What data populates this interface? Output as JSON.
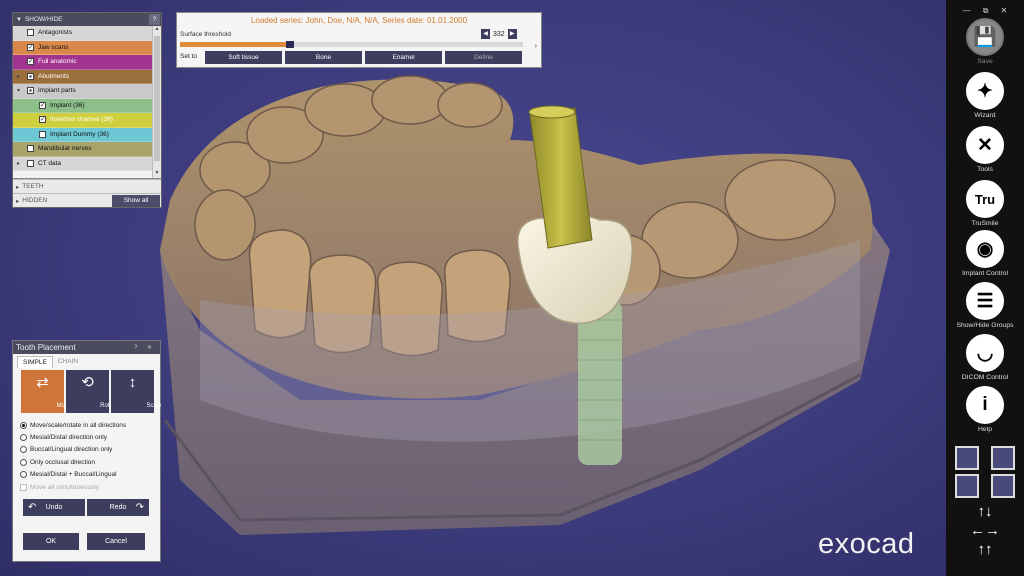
{
  "showhide": {
    "header": "SHOW/HIDE",
    "help": "?",
    "rows": [
      {
        "label": "Antagonists",
        "bg": "#d6d6d6",
        "checked": false,
        "exp": ""
      },
      {
        "label": "Jaw scans",
        "bg": "#d9884b",
        "checked": true,
        "exp": ""
      },
      {
        "label": "Full anatomic",
        "bg": "#a2338e",
        "checked": true,
        "exp": ""
      },
      {
        "label": "Abutments",
        "bg": "#9b6f3b",
        "checked": false,
        "exp": "▸",
        "filled": true
      },
      {
        "label": "Implant parts",
        "bg": "#c9c9c9",
        "checked": false,
        "exp": "▾",
        "filled": true
      },
      {
        "label": "Implant (36)",
        "bg": "#8dbf8a",
        "checked": true,
        "exp": "",
        "indent": true
      },
      {
        "label": "Insertion channel (36)",
        "bg": "#cfcf3e",
        "checked": true,
        "exp": "",
        "indent": true
      },
      {
        "label": "Implant Dummy (36)",
        "bg": "#6ec7d4",
        "checked": false,
        "exp": "",
        "indent": true
      },
      {
        "label": "Mandibular nerves",
        "bg": "#a8a36a",
        "checked": false,
        "exp": ""
      },
      {
        "label": "CT data",
        "bg": "#d6d6d6",
        "checked": false,
        "exp": "▸"
      }
    ],
    "teeth": "TEETH",
    "hidden": "HIDDEN",
    "show_all": "Show all"
  },
  "series": {
    "title": "Loaded series: John, Doe, N/A, N/A, Series date: 01.01.2000",
    "threshold_label": "Surface threshold",
    "threshold_value": "332",
    "threshold_fraction": 0.32,
    "set_to": "Set to",
    "buttons": [
      "Soft tissue",
      "Bone",
      "Enamel",
      "Define"
    ]
  },
  "tooth": {
    "title": "Tooth Placement",
    "header_icons": "? ✕",
    "tabs": [
      "SIMPLE",
      "CHAIN"
    ],
    "modes": [
      {
        "label": "Move",
        "icon": "⇄"
      },
      {
        "label": "Rotate",
        "icon": "⟲"
      },
      {
        "label": "Scale",
        "icon": "↕"
      }
    ],
    "options": [
      "Move/scale/rotate in all directions",
      "Mesial/Distal direction only",
      "Buccal/Lingual direction only",
      "Only occlusal direction",
      "Mesial/Distal + Buccal/Lingual"
    ],
    "move_all": "Move all simultaneously",
    "undo": "Undo",
    "redo": "Redo",
    "ok": "OK",
    "cancel": "Cancel"
  },
  "toolbar": {
    "win": [
      "—",
      "⧉",
      "✕"
    ],
    "tools": [
      {
        "label": "Save",
        "icon": "floppy-icon",
        "glyph": "💾"
      },
      {
        "label": "Wizard",
        "icon": "wand-icon",
        "glyph": "✦"
      },
      {
        "label": "Tools",
        "icon": "wrench-icon",
        "glyph": "✕"
      },
      {
        "label": "TruSmile",
        "icon": "trusmile-icon",
        "glyph": "Tru"
      },
      {
        "label": "Implant Control",
        "icon": "implant-icon",
        "glyph": "◉"
      },
      {
        "label": "Show/Hide Groups",
        "icon": "list-icon",
        "glyph": "☰"
      },
      {
        "label": "DICOM Control",
        "icon": "jaw-icon",
        "glyph": "◡"
      },
      {
        "label": "Help",
        "icon": "book-icon",
        "glyph": "i"
      }
    ]
  },
  "brand": "exocad"
}
